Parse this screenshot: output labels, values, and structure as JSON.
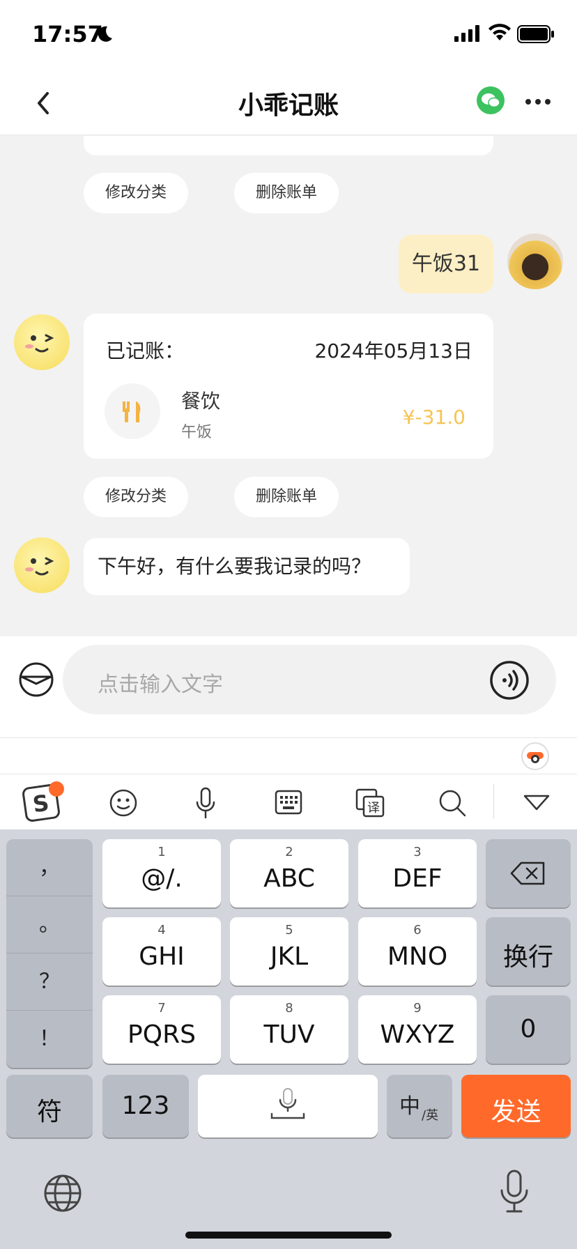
{
  "status_bar": {
    "time": "17:57"
  },
  "nav": {
    "title": "小乖记账"
  },
  "chat": {
    "top_actions": [
      "修改分类",
      "删除账单"
    ],
    "user_message": "午饭31",
    "record": {
      "label": "已记账：",
      "date": "2024年05月13日",
      "category": "餐饮",
      "note": "午饭",
      "amount": "¥-31.0"
    },
    "record_actions": [
      "修改分类",
      "删除账单"
    ],
    "bot_message": "下午好，有什么要我记录的吗？"
  },
  "input": {
    "placeholder": "点击输入文字"
  },
  "keyboard": {
    "punctuation": [
      "，",
      "。",
      "？",
      "！"
    ],
    "keys": [
      {
        "num": "1",
        "label": "@/."
      },
      {
        "num": "2",
        "label": "ABC"
      },
      {
        "num": "3",
        "label": "DEF"
      },
      {
        "num": "4",
        "label": "GHI"
      },
      {
        "num": "5",
        "label": "JKL"
      },
      {
        "num": "6",
        "label": "MNO"
      },
      {
        "num": "7",
        "label": "PQRS"
      },
      {
        "num": "8",
        "label": "TUV"
      },
      {
        "num": "9",
        "label": "WXYZ"
      }
    ],
    "newline": "换行",
    "zero": "0",
    "symbols": "符",
    "numbers": "123",
    "lang_main": "中",
    "lang_sub": "/英",
    "send": "发送"
  },
  "colors": {
    "accent": "#f6c453",
    "send": "#ff6a2b",
    "wechat": "#3cc25f"
  }
}
